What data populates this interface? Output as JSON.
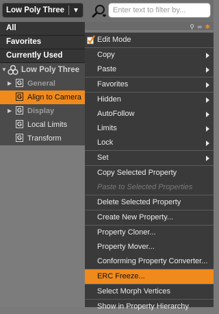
{
  "header": {
    "node_select_label": "Low Poly Three",
    "search_placeholder": "Enter text to filter by..."
  },
  "categories": [
    "All",
    "Favorites",
    "Currently Used"
  ],
  "tree": {
    "root_label": "Low Poly Three",
    "items": [
      {
        "label": "General",
        "type": "group"
      },
      {
        "label": "Align to Camera",
        "type": "property",
        "selected": true
      },
      {
        "label": "Display",
        "type": "group"
      },
      {
        "label": "Local Limits",
        "type": "property"
      },
      {
        "label": "Transform",
        "type": "property"
      }
    ]
  },
  "menu": {
    "items": [
      {
        "label": "Edit Mode",
        "checked": true
      },
      {
        "label": "Copy",
        "submenu": true
      },
      {
        "label": "Paste",
        "submenu": true
      },
      {
        "label": "Favorites",
        "submenu": true
      },
      {
        "label": "Hidden",
        "submenu": true
      },
      {
        "label": "AutoFollow",
        "submenu": true
      },
      {
        "label": "Limits",
        "submenu": true
      },
      {
        "label": "Lock",
        "submenu": true
      },
      {
        "label": "Set",
        "submenu": true
      },
      {
        "label": "Copy Selected Property"
      },
      {
        "label": "Paste to Selected Properties",
        "disabled": true
      },
      {
        "label": "Delete Selected Property"
      },
      {
        "label": "Create New Property..."
      },
      {
        "label": "Property Cloner..."
      },
      {
        "label": "Property Mover..."
      },
      {
        "label": "Conforming Property Converter..."
      },
      {
        "label": "ERC Freeze...",
        "highlight": true
      },
      {
        "label": "Select Morph Vertices"
      },
      {
        "label": "Show in Property Hierarchy"
      }
    ]
  },
  "colors": {
    "accent": "#f08a1c",
    "menu_bg": "#3a3a3a",
    "panel_bg": "#7c7c7c"
  }
}
